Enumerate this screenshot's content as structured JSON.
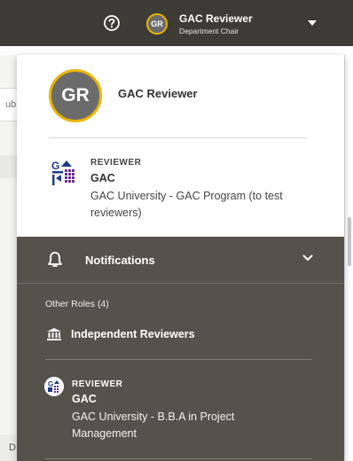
{
  "header": {
    "user_name": "GAC Reviewer",
    "user_role": "Department Chair",
    "avatar_initials": "GR",
    "icons": {
      "help": "question-circle-icon",
      "caret": "caret-down-icon"
    }
  },
  "profile": {
    "avatar_initials": "GR",
    "name": "GAC Reviewer"
  },
  "current_role": {
    "label": "REVIEWER",
    "program": "GAC",
    "description": "GAC University - GAC Program (to test reviewers)"
  },
  "notifications": {
    "label": "Notifications",
    "icons": {
      "bell": "bell-icon",
      "chevron": "chevron-down-icon"
    }
  },
  "other_roles": {
    "heading": "Other Roles (4)",
    "items": [
      {
        "label": "Independent Reviewers",
        "icon": "institution-icon"
      },
      {
        "role": "REVIEWER",
        "program": "GAC",
        "description": "GAC University - B.B.A in Project Management",
        "icon": "gac-logo-icon"
      }
    ]
  },
  "background": {
    "partial_field_text": "ub",
    "partial_bottom_text": "D"
  },
  "colors": {
    "topbar": "#3d3b36",
    "dark_section": "#55524b",
    "accent_ring": "#e8b500",
    "logo_blue": "#1d3a8a",
    "logo_purple": "#6a2d91"
  }
}
